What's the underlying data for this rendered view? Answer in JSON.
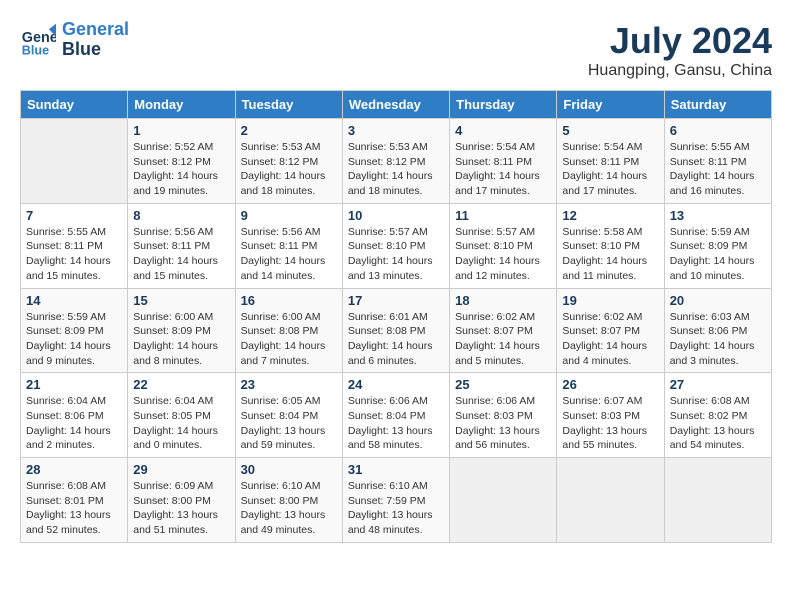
{
  "header": {
    "logo_line1": "General",
    "logo_line2": "Blue",
    "month": "July 2024",
    "location": "Huangping, Gansu, China"
  },
  "columns": [
    "Sunday",
    "Monday",
    "Tuesday",
    "Wednesday",
    "Thursday",
    "Friday",
    "Saturday"
  ],
  "weeks": [
    [
      {
        "day": "",
        "info": ""
      },
      {
        "day": "1",
        "info": "Sunrise: 5:52 AM\nSunset: 8:12 PM\nDaylight: 14 hours\nand 19 minutes."
      },
      {
        "day": "2",
        "info": "Sunrise: 5:53 AM\nSunset: 8:12 PM\nDaylight: 14 hours\nand 18 minutes."
      },
      {
        "day": "3",
        "info": "Sunrise: 5:53 AM\nSunset: 8:12 PM\nDaylight: 14 hours\nand 18 minutes."
      },
      {
        "day": "4",
        "info": "Sunrise: 5:54 AM\nSunset: 8:11 PM\nDaylight: 14 hours\nand 17 minutes."
      },
      {
        "day": "5",
        "info": "Sunrise: 5:54 AM\nSunset: 8:11 PM\nDaylight: 14 hours\nand 17 minutes."
      },
      {
        "day": "6",
        "info": "Sunrise: 5:55 AM\nSunset: 8:11 PM\nDaylight: 14 hours\nand 16 minutes."
      }
    ],
    [
      {
        "day": "7",
        "info": "Sunrise: 5:55 AM\nSunset: 8:11 PM\nDaylight: 14 hours\nand 15 minutes."
      },
      {
        "day": "8",
        "info": "Sunrise: 5:56 AM\nSunset: 8:11 PM\nDaylight: 14 hours\nand 15 minutes."
      },
      {
        "day": "9",
        "info": "Sunrise: 5:56 AM\nSunset: 8:11 PM\nDaylight: 14 hours\nand 14 minutes."
      },
      {
        "day": "10",
        "info": "Sunrise: 5:57 AM\nSunset: 8:10 PM\nDaylight: 14 hours\nand 13 minutes."
      },
      {
        "day": "11",
        "info": "Sunrise: 5:57 AM\nSunset: 8:10 PM\nDaylight: 14 hours\nand 12 minutes."
      },
      {
        "day": "12",
        "info": "Sunrise: 5:58 AM\nSunset: 8:10 PM\nDaylight: 14 hours\nand 11 minutes."
      },
      {
        "day": "13",
        "info": "Sunrise: 5:59 AM\nSunset: 8:09 PM\nDaylight: 14 hours\nand 10 minutes."
      }
    ],
    [
      {
        "day": "14",
        "info": "Sunrise: 5:59 AM\nSunset: 8:09 PM\nDaylight: 14 hours\nand 9 minutes."
      },
      {
        "day": "15",
        "info": "Sunrise: 6:00 AM\nSunset: 8:09 PM\nDaylight: 14 hours\nand 8 minutes."
      },
      {
        "day": "16",
        "info": "Sunrise: 6:00 AM\nSunset: 8:08 PM\nDaylight: 14 hours\nand 7 minutes."
      },
      {
        "day": "17",
        "info": "Sunrise: 6:01 AM\nSunset: 8:08 PM\nDaylight: 14 hours\nand 6 minutes."
      },
      {
        "day": "18",
        "info": "Sunrise: 6:02 AM\nSunset: 8:07 PM\nDaylight: 14 hours\nand 5 minutes."
      },
      {
        "day": "19",
        "info": "Sunrise: 6:02 AM\nSunset: 8:07 PM\nDaylight: 14 hours\nand 4 minutes."
      },
      {
        "day": "20",
        "info": "Sunrise: 6:03 AM\nSunset: 8:06 PM\nDaylight: 14 hours\nand 3 minutes."
      }
    ],
    [
      {
        "day": "21",
        "info": "Sunrise: 6:04 AM\nSunset: 8:06 PM\nDaylight: 14 hours\nand 2 minutes."
      },
      {
        "day": "22",
        "info": "Sunrise: 6:04 AM\nSunset: 8:05 PM\nDaylight: 14 hours\nand 0 minutes."
      },
      {
        "day": "23",
        "info": "Sunrise: 6:05 AM\nSunset: 8:04 PM\nDaylight: 13 hours\nand 59 minutes."
      },
      {
        "day": "24",
        "info": "Sunrise: 6:06 AM\nSunset: 8:04 PM\nDaylight: 13 hours\nand 58 minutes."
      },
      {
        "day": "25",
        "info": "Sunrise: 6:06 AM\nSunset: 8:03 PM\nDaylight: 13 hours\nand 56 minutes."
      },
      {
        "day": "26",
        "info": "Sunrise: 6:07 AM\nSunset: 8:03 PM\nDaylight: 13 hours\nand 55 minutes."
      },
      {
        "day": "27",
        "info": "Sunrise: 6:08 AM\nSunset: 8:02 PM\nDaylight: 13 hours\nand 54 minutes."
      }
    ],
    [
      {
        "day": "28",
        "info": "Sunrise: 6:08 AM\nSunset: 8:01 PM\nDaylight: 13 hours\nand 52 minutes."
      },
      {
        "day": "29",
        "info": "Sunrise: 6:09 AM\nSunset: 8:00 PM\nDaylight: 13 hours\nand 51 minutes."
      },
      {
        "day": "30",
        "info": "Sunrise: 6:10 AM\nSunset: 8:00 PM\nDaylight: 13 hours\nand 49 minutes."
      },
      {
        "day": "31",
        "info": "Sunrise: 6:10 AM\nSunset: 7:59 PM\nDaylight: 13 hours\nand 48 minutes."
      },
      {
        "day": "",
        "info": ""
      },
      {
        "day": "",
        "info": ""
      },
      {
        "day": "",
        "info": ""
      }
    ]
  ]
}
